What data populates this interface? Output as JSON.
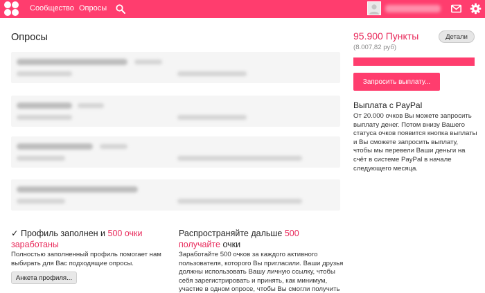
{
  "nav": {
    "community": "Сообщество",
    "surveys": "Опросы"
  },
  "page": {
    "title": "Опросы"
  },
  "profile_section": {
    "heading_prefix": "Профиль заполнен и ",
    "heading_accent": "500 очки заработаны",
    "text": "Полностью заполненный профиль помогает нам выбирать для Вас подходящие опросы.",
    "button": "Анкета профиля..."
  },
  "referral_section": {
    "heading_prefix": "Распространяйте дальше ",
    "heading_accent": "500 получайте",
    "heading_suffix": "очки",
    "text": "Заработайте 500 очков за каждого активного пользователя, которого Вы пригласили. Ваши друзья должны использовать Вашу личную ссылку, чтобы себя зарегистрировать и принять, как минимум, участие в одном опросе, чтобы Вы смогли получить Ваши очки."
  },
  "account": {
    "points": "95.900 Пункты",
    "rub": "(8.007,82 руб)",
    "details_button": "Детали",
    "progress_fraction": 1.0,
    "payout_button": "Запросить выплату..."
  },
  "paypal": {
    "heading": "Выплата с PayPal",
    "text": "От 20.000 очков Вы можете запросить выплату денег. Потом внизу Вашего статуса очков появится кнопка выплаты и Вы сможете запросить выплату, чтобы мы перевели Ваши деньги на счёт в системе PayPal в начале следующего месяца."
  },
  "icons": {
    "logo": "four-circles-logo",
    "search": "search-icon",
    "mail": "mail-icon",
    "settings": "gear-icon"
  },
  "colors": {
    "brand": "#ff3d6e",
    "accent_text": "#e8295a",
    "card_bg": "#f5f5f5"
  }
}
